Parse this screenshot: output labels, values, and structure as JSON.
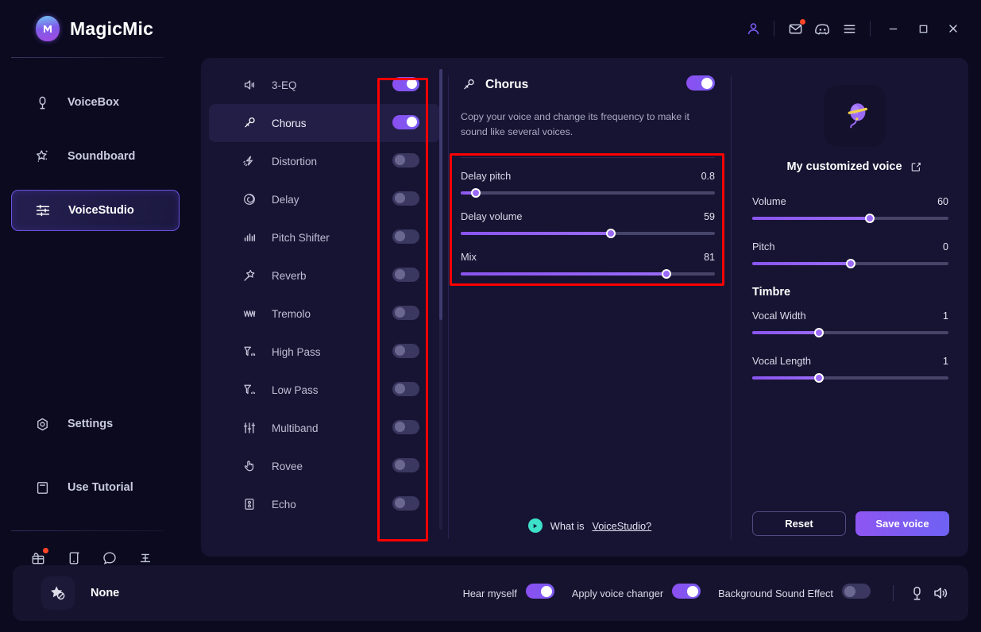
{
  "app": {
    "brand": "MagicMic",
    "logo_icon": "magicmic-logo-icon"
  },
  "titlebar": {
    "icons": [
      {
        "name": "account-icon",
        "glyph": "user"
      },
      {
        "name": "mail-icon",
        "glyph": "mail",
        "badge": true
      },
      {
        "name": "discord-icon",
        "glyph": "discord"
      },
      {
        "name": "menu-icon",
        "glyph": "hamburger"
      }
    ],
    "window_controls": [
      {
        "name": "minimize-button",
        "glyph": "minimize"
      },
      {
        "name": "maximize-button",
        "glyph": "maximize"
      },
      {
        "name": "close-button",
        "glyph": "close"
      }
    ]
  },
  "sidebar": {
    "items": [
      {
        "label": "VoiceBox",
        "icon": "microphone-icon",
        "active": false
      },
      {
        "label": "Soundboard",
        "icon": "sparkle-star-icon",
        "active": false
      },
      {
        "label": "VoiceStudio",
        "icon": "sliders-icon",
        "active": true
      }
    ],
    "bottom_items": [
      {
        "label": "Settings",
        "icon": "gear-icon"
      },
      {
        "label": "Use Tutorial",
        "icon": "book-icon"
      }
    ],
    "mini_icons": [
      {
        "name": "gift-box-icon",
        "badge": true
      },
      {
        "name": "mobile-device-icon",
        "badge": false
      },
      {
        "name": "chat-bubble-icon",
        "badge": false
      },
      {
        "name": "share-network-icon",
        "badge": false
      }
    ]
  },
  "effects": {
    "items": [
      {
        "label": "3-EQ",
        "icon": "speaker-icon",
        "enabled": true,
        "selected": false
      },
      {
        "label": "Chorus",
        "icon": "magnifier-mic-icon",
        "enabled": true,
        "selected": true
      },
      {
        "label": "Distortion",
        "icon": "distortion-icon",
        "enabled": false,
        "selected": false
      },
      {
        "label": "Delay",
        "icon": "spiral-icon",
        "enabled": false,
        "selected": false
      },
      {
        "label": "Pitch Shifter",
        "icon": "bar-levels-icon",
        "enabled": false,
        "selected": false
      },
      {
        "label": "Reverb",
        "icon": "magic-wand-icon",
        "enabled": false,
        "selected": false
      },
      {
        "label": "Tremolo",
        "icon": "waveform-w-icon",
        "enabled": false,
        "selected": false
      },
      {
        "label": "High Pass",
        "icon": "high-pass-icon",
        "enabled": false,
        "selected": false
      },
      {
        "label": "Low Pass",
        "icon": "low-pass-icon",
        "enabled": false,
        "selected": false
      },
      {
        "label": "Multiband",
        "icon": "multiband-icon",
        "enabled": false,
        "selected": false
      },
      {
        "label": "Rovee",
        "icon": "hand-pointer-icon",
        "enabled": false,
        "selected": false
      },
      {
        "label": "Echo",
        "icon": "echo-icon",
        "enabled": false,
        "selected": false
      }
    ]
  },
  "detail": {
    "title": "Chorus",
    "icon": "magnifier-mic-icon",
    "enabled": true,
    "description": "Copy your voice and change its frequency to make it sound like several voices.",
    "params": [
      {
        "name": "Delay pitch",
        "value": "0.8",
        "percent": 6
      },
      {
        "name": "Delay volume",
        "value": "59",
        "percent": 59
      },
      {
        "name": "Mix",
        "value": "81",
        "percent": 81
      }
    ],
    "footer_prefix": "What is ",
    "footer_link": "VoiceStudio?",
    "footer_icon": "play-circle-icon"
  },
  "voice": {
    "avatar_icon": "balloon-voice-avatar-icon",
    "name": "My customized voice",
    "edit_icon": "edit-square-icon",
    "params": [
      {
        "name": "Volume",
        "value": "60",
        "percent": 60
      },
      {
        "name": "Pitch",
        "value": "0",
        "percent": 50
      }
    ],
    "timbre_title": "Timbre",
    "timbre_params": [
      {
        "name": "Vocal Width",
        "value": "1",
        "percent": 34
      },
      {
        "name": "Vocal Length",
        "value": "1",
        "percent": 34
      }
    ],
    "reset_label": "Reset",
    "save_label": "Save voice"
  },
  "bottombar": {
    "voice_chip_label": "None",
    "voice_chip_icon": "star-none-icon",
    "toggles": [
      {
        "label": "Hear myself",
        "enabled": true
      },
      {
        "label": "Apply voice changer",
        "enabled": true
      },
      {
        "label": "Background Sound Effect",
        "enabled": false
      }
    ],
    "icons": [
      {
        "name": "microphone-icon"
      },
      {
        "name": "speaker-volume-icon"
      }
    ]
  },
  "annotations": {
    "box1_name": "effects-toggles-highlight",
    "box2_name": "chorus-params-highlight"
  },
  "colors": {
    "accent": "#8a54f0",
    "accent2": "#6f62f3",
    "panel": "#171433",
    "background": "#0b0a1f",
    "highlight": "#ff0000",
    "teal": "#3de0c8",
    "badge": "#ff4526"
  }
}
